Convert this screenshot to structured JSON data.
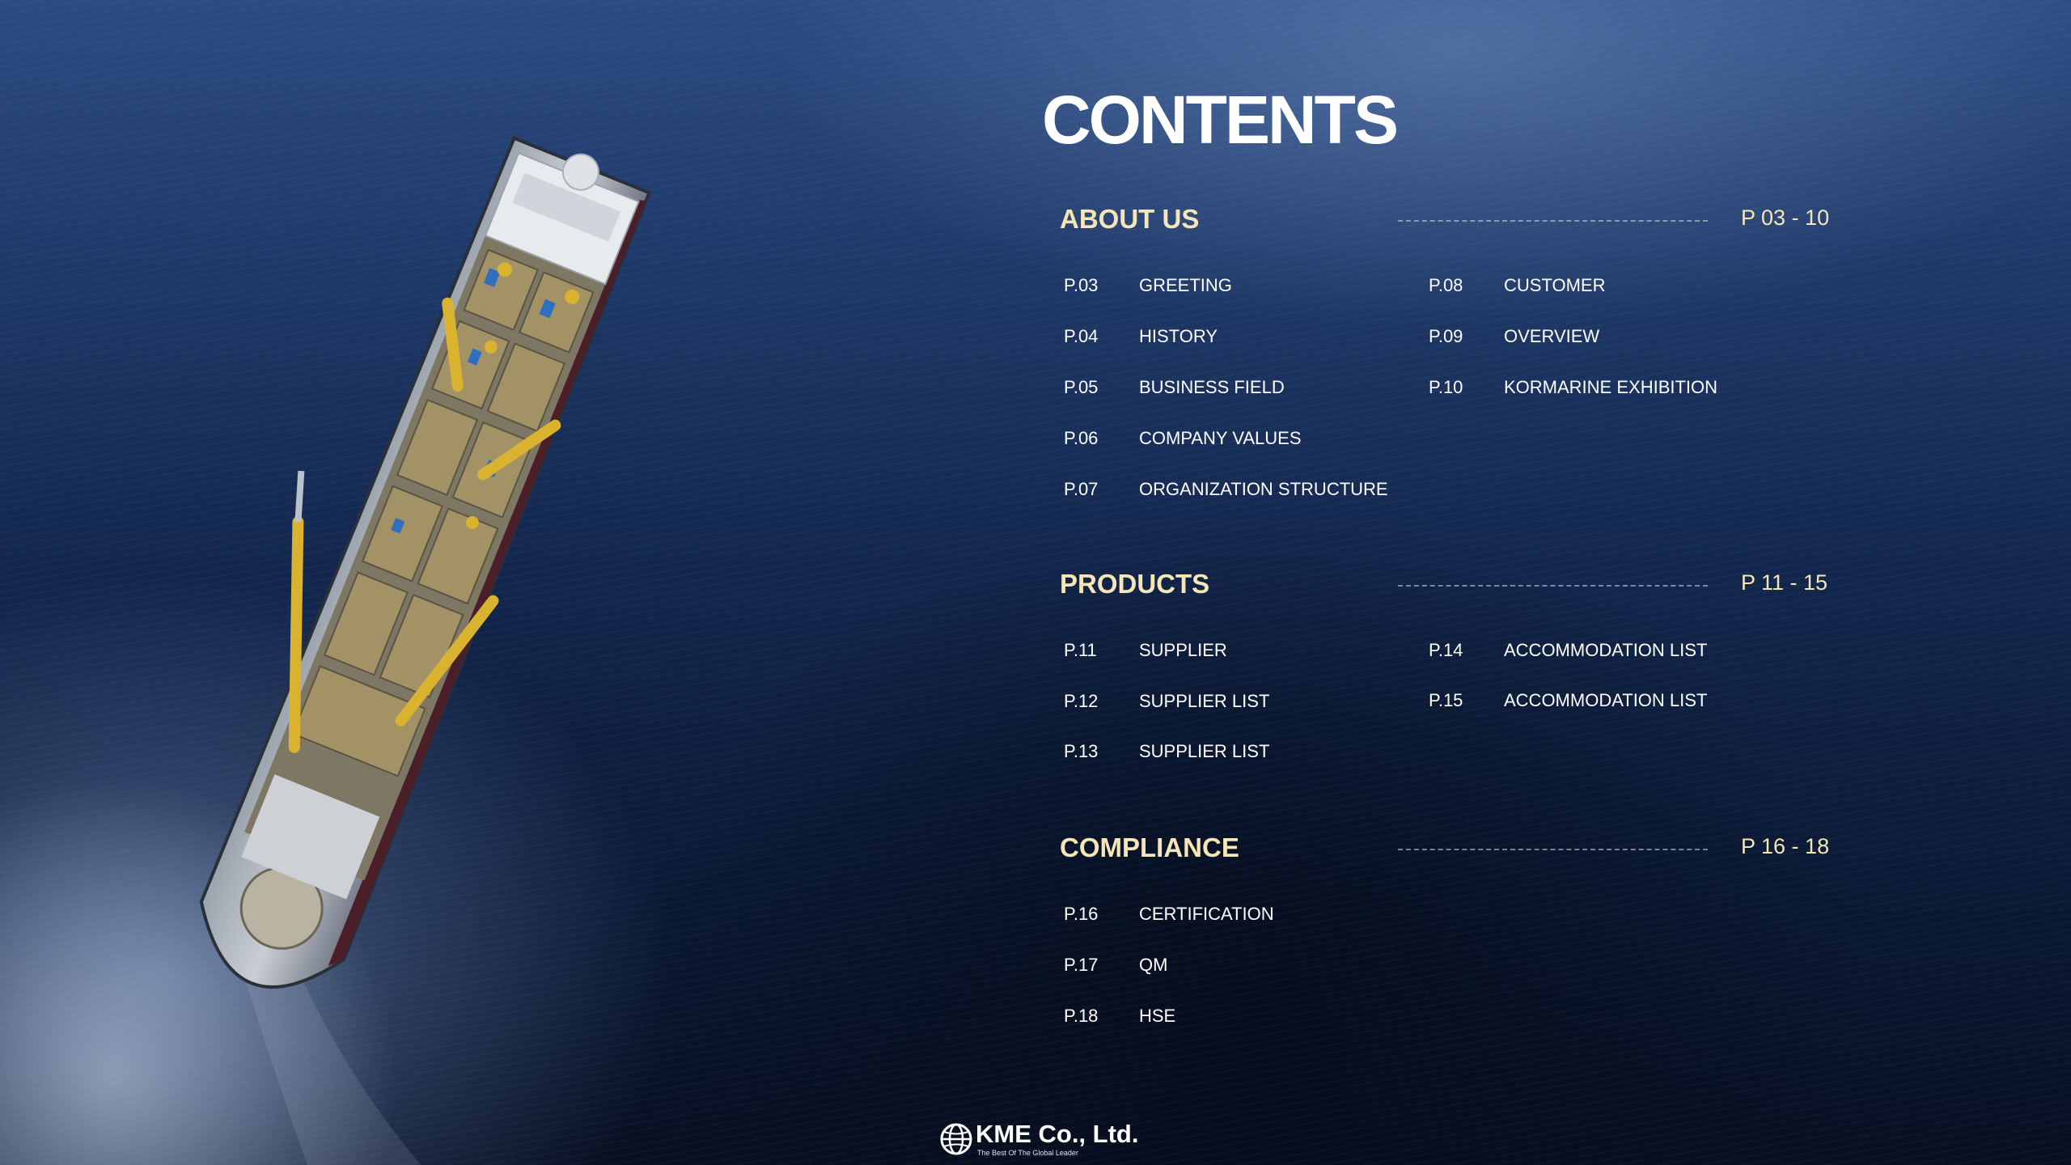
{
  "title": "CONTENTS",
  "sections": [
    {
      "title": "ABOUT US",
      "range": "P 03 - 10",
      "left_items": [
        {
          "page": "P.03",
          "label": "GREETING"
        },
        {
          "page": "P.04",
          "label": "HISTORY"
        },
        {
          "page": "P.05",
          "label": "BUSINESS FIELD"
        },
        {
          "page": "P.06",
          "label": "COMPANY VALUES"
        },
        {
          "page": "P.07",
          "label": "ORGANIZATION STRUCTURE"
        }
      ],
      "right_items": [
        {
          "page": "P.08",
          "label": "CUSTOMER"
        },
        {
          "page": "P.09",
          "label": "OVERVIEW"
        },
        {
          "page": "P.10",
          "label": "KORMARINE EXHIBITION"
        }
      ]
    },
    {
      "title": "PRODUCTS",
      "range": "P 11 - 15",
      "left_items": [
        {
          "page": "P.11",
          "label": "SUPPLIER"
        },
        {
          "page": "P.12",
          "label": "SUPPLIER LIST"
        },
        {
          "page": "P.13",
          "label": "SUPPLIER LIST"
        }
      ],
      "right_items": [
        {
          "page": "P.14",
          "label": "ACCOMMODATION LIST"
        },
        {
          "page": "P.15",
          "label": "ACCOMMODATION LIST"
        }
      ]
    },
    {
      "title": "COMPLIANCE",
      "range": "P 16 - 18",
      "left_items": [
        {
          "page": "P.16",
          "label": "CERTIFICATION"
        },
        {
          "page": "P.17",
          "label": "QM"
        },
        {
          "page": "P.18",
          "label": "HSE"
        }
      ],
      "right_items": []
    }
  ],
  "logo": {
    "name": "KME Co., Ltd.",
    "tagline": "The Best Of The Global Leader",
    "icon": "globe-icon"
  },
  "colors": {
    "heading_accent": "#f5e6b8",
    "text": "#ffffff",
    "sea_dark": "#070f22",
    "sea_light": "#2c4b82",
    "crane_yellow": "#d9b230"
  },
  "image": {
    "icon": "fpso-ship-photo"
  }
}
